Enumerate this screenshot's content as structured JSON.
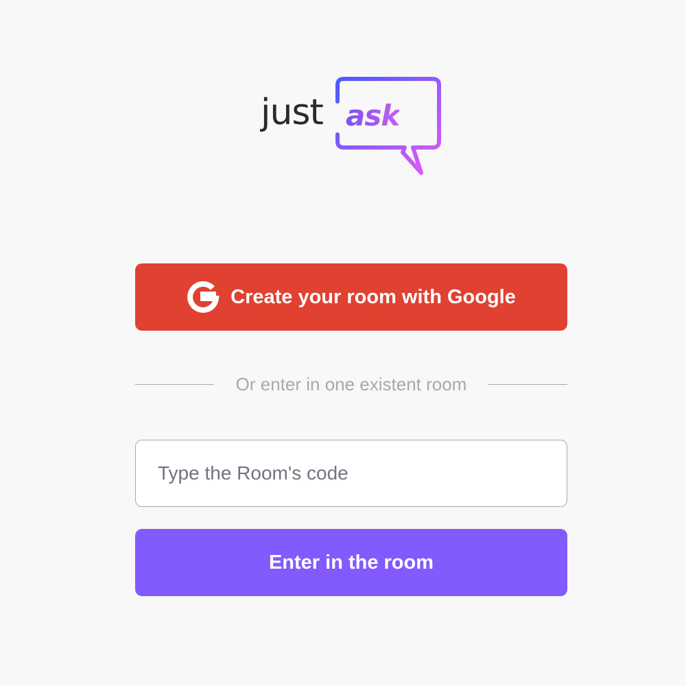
{
  "logo": {
    "word_just": "just",
    "word_ask": "ask",
    "icon": "speech-bubble-icon"
  },
  "google_button": {
    "label": "Create your room with Google",
    "icon": "google-icon"
  },
  "separator": {
    "text": "Or enter in one existent room"
  },
  "room_input": {
    "placeholder": "Type the Room's code",
    "value": ""
  },
  "enter_button": {
    "label": "Enter in the room"
  },
  "colors": {
    "background": "#f8f8f8",
    "google_red": "#e04131",
    "primary_purple": "#835afd",
    "gradient_start": "#485bff",
    "gradient_end": "#e559f9",
    "text_dark": "#29292e",
    "muted_gray": "#a8a8b3"
  }
}
